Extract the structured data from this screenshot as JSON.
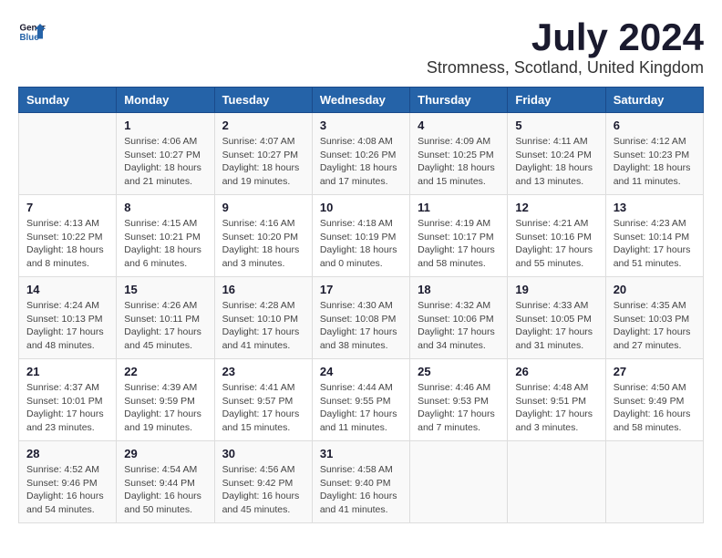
{
  "logo": {
    "general": "General",
    "blue": "Blue"
  },
  "title": "July 2024",
  "location": "Stromness, Scotland, United Kingdom",
  "headers": [
    "Sunday",
    "Monday",
    "Tuesday",
    "Wednesday",
    "Thursday",
    "Friday",
    "Saturday"
  ],
  "weeks": [
    [
      {
        "day": "",
        "sunrise": "",
        "sunset": "",
        "daylight": ""
      },
      {
        "day": "1",
        "sunrise": "Sunrise: 4:06 AM",
        "sunset": "Sunset: 10:27 PM",
        "daylight": "Daylight: 18 hours and 21 minutes."
      },
      {
        "day": "2",
        "sunrise": "Sunrise: 4:07 AM",
        "sunset": "Sunset: 10:27 PM",
        "daylight": "Daylight: 18 hours and 19 minutes."
      },
      {
        "day": "3",
        "sunrise": "Sunrise: 4:08 AM",
        "sunset": "Sunset: 10:26 PM",
        "daylight": "Daylight: 18 hours and 17 minutes."
      },
      {
        "day": "4",
        "sunrise": "Sunrise: 4:09 AM",
        "sunset": "Sunset: 10:25 PM",
        "daylight": "Daylight: 18 hours and 15 minutes."
      },
      {
        "day": "5",
        "sunrise": "Sunrise: 4:11 AM",
        "sunset": "Sunset: 10:24 PM",
        "daylight": "Daylight: 18 hours and 13 minutes."
      },
      {
        "day": "6",
        "sunrise": "Sunrise: 4:12 AM",
        "sunset": "Sunset: 10:23 PM",
        "daylight": "Daylight: 18 hours and 11 minutes."
      }
    ],
    [
      {
        "day": "7",
        "sunrise": "Sunrise: 4:13 AM",
        "sunset": "Sunset: 10:22 PM",
        "daylight": "Daylight: 18 hours and 8 minutes."
      },
      {
        "day": "8",
        "sunrise": "Sunrise: 4:15 AM",
        "sunset": "Sunset: 10:21 PM",
        "daylight": "Daylight: 18 hours and 6 minutes."
      },
      {
        "day": "9",
        "sunrise": "Sunrise: 4:16 AM",
        "sunset": "Sunset: 10:20 PM",
        "daylight": "Daylight: 18 hours and 3 minutes."
      },
      {
        "day": "10",
        "sunrise": "Sunrise: 4:18 AM",
        "sunset": "Sunset: 10:19 PM",
        "daylight": "Daylight: 18 hours and 0 minutes."
      },
      {
        "day": "11",
        "sunrise": "Sunrise: 4:19 AM",
        "sunset": "Sunset: 10:17 PM",
        "daylight": "Daylight: 17 hours and 58 minutes."
      },
      {
        "day": "12",
        "sunrise": "Sunrise: 4:21 AM",
        "sunset": "Sunset: 10:16 PM",
        "daylight": "Daylight: 17 hours and 55 minutes."
      },
      {
        "day": "13",
        "sunrise": "Sunrise: 4:23 AM",
        "sunset": "Sunset: 10:14 PM",
        "daylight": "Daylight: 17 hours and 51 minutes."
      }
    ],
    [
      {
        "day": "14",
        "sunrise": "Sunrise: 4:24 AM",
        "sunset": "Sunset: 10:13 PM",
        "daylight": "Daylight: 17 hours and 48 minutes."
      },
      {
        "day": "15",
        "sunrise": "Sunrise: 4:26 AM",
        "sunset": "Sunset: 10:11 PM",
        "daylight": "Daylight: 17 hours and 45 minutes."
      },
      {
        "day": "16",
        "sunrise": "Sunrise: 4:28 AM",
        "sunset": "Sunset: 10:10 PM",
        "daylight": "Daylight: 17 hours and 41 minutes."
      },
      {
        "day": "17",
        "sunrise": "Sunrise: 4:30 AM",
        "sunset": "Sunset: 10:08 PM",
        "daylight": "Daylight: 17 hours and 38 minutes."
      },
      {
        "day": "18",
        "sunrise": "Sunrise: 4:32 AM",
        "sunset": "Sunset: 10:06 PM",
        "daylight": "Daylight: 17 hours and 34 minutes."
      },
      {
        "day": "19",
        "sunrise": "Sunrise: 4:33 AM",
        "sunset": "Sunset: 10:05 PM",
        "daylight": "Daylight: 17 hours and 31 minutes."
      },
      {
        "day": "20",
        "sunrise": "Sunrise: 4:35 AM",
        "sunset": "Sunset: 10:03 PM",
        "daylight": "Daylight: 17 hours and 27 minutes."
      }
    ],
    [
      {
        "day": "21",
        "sunrise": "Sunrise: 4:37 AM",
        "sunset": "Sunset: 10:01 PM",
        "daylight": "Daylight: 17 hours and 23 minutes."
      },
      {
        "day": "22",
        "sunrise": "Sunrise: 4:39 AM",
        "sunset": "Sunset: 9:59 PM",
        "daylight": "Daylight: 17 hours and 19 minutes."
      },
      {
        "day": "23",
        "sunrise": "Sunrise: 4:41 AM",
        "sunset": "Sunset: 9:57 PM",
        "daylight": "Daylight: 17 hours and 15 minutes."
      },
      {
        "day": "24",
        "sunrise": "Sunrise: 4:44 AM",
        "sunset": "Sunset: 9:55 PM",
        "daylight": "Daylight: 17 hours and 11 minutes."
      },
      {
        "day": "25",
        "sunrise": "Sunrise: 4:46 AM",
        "sunset": "Sunset: 9:53 PM",
        "daylight": "Daylight: 17 hours and 7 minutes."
      },
      {
        "day": "26",
        "sunrise": "Sunrise: 4:48 AM",
        "sunset": "Sunset: 9:51 PM",
        "daylight": "Daylight: 17 hours and 3 minutes."
      },
      {
        "day": "27",
        "sunrise": "Sunrise: 4:50 AM",
        "sunset": "Sunset: 9:49 PM",
        "daylight": "Daylight: 16 hours and 58 minutes."
      }
    ],
    [
      {
        "day": "28",
        "sunrise": "Sunrise: 4:52 AM",
        "sunset": "Sunset: 9:46 PM",
        "daylight": "Daylight: 16 hours and 54 minutes."
      },
      {
        "day": "29",
        "sunrise": "Sunrise: 4:54 AM",
        "sunset": "Sunset: 9:44 PM",
        "daylight": "Daylight: 16 hours and 50 minutes."
      },
      {
        "day": "30",
        "sunrise": "Sunrise: 4:56 AM",
        "sunset": "Sunset: 9:42 PM",
        "daylight": "Daylight: 16 hours and 45 minutes."
      },
      {
        "day": "31",
        "sunrise": "Sunrise: 4:58 AM",
        "sunset": "Sunset: 9:40 PM",
        "daylight": "Daylight: 16 hours and 41 minutes."
      },
      {
        "day": "",
        "sunrise": "",
        "sunset": "",
        "daylight": ""
      },
      {
        "day": "",
        "sunrise": "",
        "sunset": "",
        "daylight": ""
      },
      {
        "day": "",
        "sunrise": "",
        "sunset": "",
        "daylight": ""
      }
    ]
  ]
}
